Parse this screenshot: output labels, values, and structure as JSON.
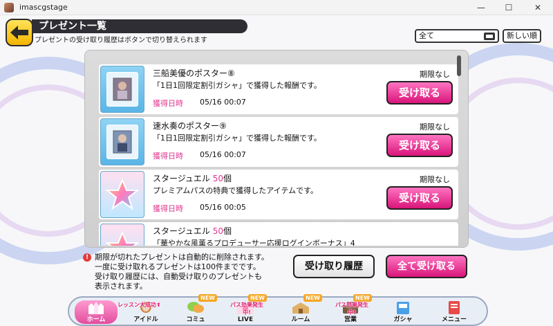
{
  "window": {
    "title": "imascgstage",
    "minimize": "—",
    "maximize": "☐",
    "close": "✕"
  },
  "header": {
    "title": "プレゼント一覧",
    "subtitle": "プレゼントの受け取り履歴はボタンで切り替えられます",
    "sort_value": "全て",
    "newest_label": "新しい順"
  },
  "items": [
    {
      "name": "三船美優のポスター⑧",
      "qty": "",
      "qty_unit": "",
      "expiry": "期限なし",
      "desc": "「1日1回限定割引ガシャ」で獲得した報酬です。",
      "acq_label": "獲得日時",
      "acq_date": "05/16 00:07",
      "button": "受け取る",
      "icon": "poster-icon"
    },
    {
      "name": "速水奏のポスター⑨",
      "qty": "",
      "qty_unit": "",
      "expiry": "期限なし",
      "desc": "「1日1回限定割引ガシャ」で獲得した報酬です。",
      "acq_label": "獲得日時",
      "acq_date": "05/16 00:07",
      "button": "受け取る",
      "icon": "poster-icon"
    },
    {
      "name": "スタージュエル",
      "qty": "50",
      "qty_unit": "個",
      "expiry": "期限なし",
      "desc": "プレミアムパスの特典で獲得したアイテムです。",
      "acq_label": "獲得日時",
      "acq_date": "05/16 00:05",
      "button": "受け取る",
      "icon": "star-jewel-icon"
    },
    {
      "name": "スタージュエル",
      "qty": "50",
      "qty_unit": "個",
      "expiry": "",
      "desc": "「華やかな風薫るプロデューサー応援ログインボーナス」4",
      "acq_label": "",
      "acq_date": "",
      "button": "",
      "icon": "star-jewel-icon"
    }
  ],
  "footer": {
    "notice_lines": [
      "期限が切れたプレゼントは自動的に削除されます。",
      "一度に受け取れるプレゼントは100件までです。",
      "受け取り履歴には、自動受け取りのプレゼントも",
      "表示されます。"
    ],
    "history_button": "受け取り履歴",
    "receive_all_button": "全て受け取る"
  },
  "nav": [
    {
      "label": "ホーム",
      "badge": "",
      "new": ""
    },
    {
      "label": "アイドル",
      "badge": "レッスン大成功⬆",
      "new": ""
    },
    {
      "label": "コミュ",
      "badge": "",
      "new": "NEW"
    },
    {
      "label": "LIVE",
      "badge": "パス効果発生中!",
      "new": "NEW"
    },
    {
      "label": "ルーム",
      "badge": "",
      "new": "NEW"
    },
    {
      "label": "営業",
      "badge": "パス効果発生中!",
      "new": "NEW"
    },
    {
      "label": "ガシャ",
      "badge": "",
      "new": ""
    },
    {
      "label": "メニュー",
      "badge": "",
      "new": ""
    }
  ],
  "colors": {
    "accent_pink": "#e0368f",
    "header_dark": "#2e2e34",
    "back_yellow": "#f5b500"
  }
}
